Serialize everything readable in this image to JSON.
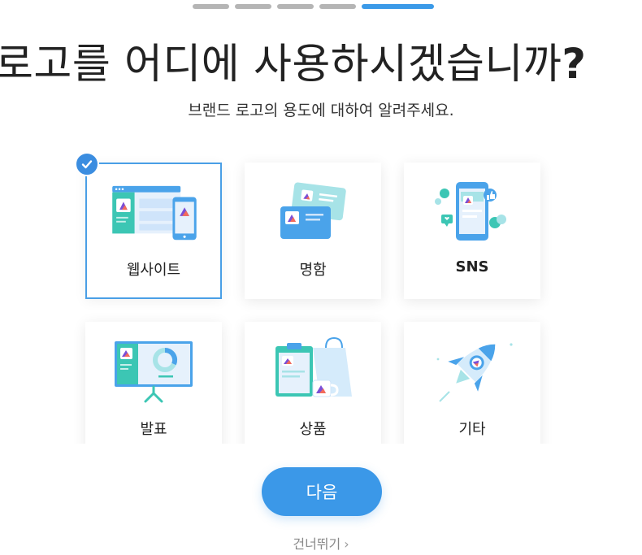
{
  "progress": {
    "total_steps": 5,
    "current_step": 5
  },
  "header": {
    "title": "로고를 어디에 사용하시겠습니까",
    "title_mark": "?",
    "subtitle": "브랜드 로고의 용도에 대하여 알려주세요."
  },
  "options": [
    {
      "label": "웹사이트",
      "icon": "website-illustration",
      "selected": true
    },
    {
      "label": "명함",
      "icon": "business-card-illustration",
      "selected": false
    },
    {
      "label": "SNS",
      "icon": "sns-illustration",
      "selected": false
    },
    {
      "label": "발표",
      "icon": "presentation-illustration",
      "selected": false
    },
    {
      "label": "상품",
      "icon": "product-illustration",
      "selected": false
    },
    {
      "label": "기타",
      "icon": "rocket-illustration",
      "selected": false
    }
  ],
  "actions": {
    "next_label": "다음",
    "skip_label": "건너뛰기",
    "skip_icon": "chevron-right-icon"
  },
  "colors": {
    "accent": "#3b98e8",
    "progress_inactive": "#b5b5b5",
    "illustration_teal": "#3cc6b4",
    "illustration_blue": "#4aa3ea"
  }
}
